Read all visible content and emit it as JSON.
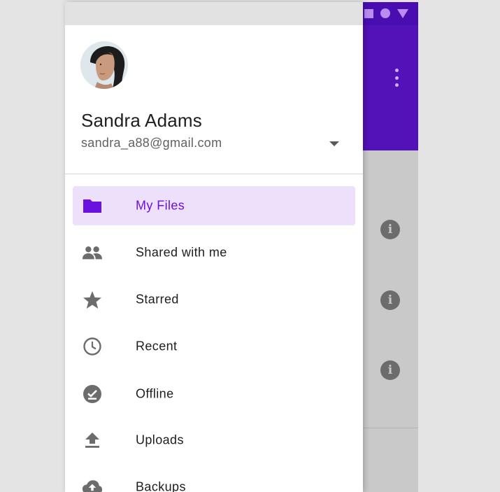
{
  "account": {
    "name": "Sandra Adams",
    "email": "sandra_a88@gmail.com"
  },
  "nav": {
    "items": [
      {
        "label": "My Files",
        "icon": "folder-icon",
        "active": true
      },
      {
        "label": "Shared with me",
        "icon": "people-icon"
      },
      {
        "label": "Starred",
        "icon": "star-icon"
      },
      {
        "label": "Recent",
        "icon": "clock-icon"
      },
      {
        "label": "Offline",
        "icon": "offline-check-icon"
      },
      {
        "label": "Uploads",
        "icon": "upload-icon"
      },
      {
        "label": "Backups",
        "icon": "cloud-upload-icon"
      }
    ]
  },
  "colors": {
    "primary": "#5212b8",
    "primary_dark": "#4a0db0",
    "accent_text": "#6a11e0",
    "active_bg": "#ece0fb",
    "icon_gray": "#6c6c6c"
  },
  "background_app": {
    "info_icons": [
      "info-icon",
      "info-icon",
      "info-icon"
    ],
    "status_icons": [
      "square-icon",
      "circle-icon",
      "triangle-icon"
    ]
  }
}
